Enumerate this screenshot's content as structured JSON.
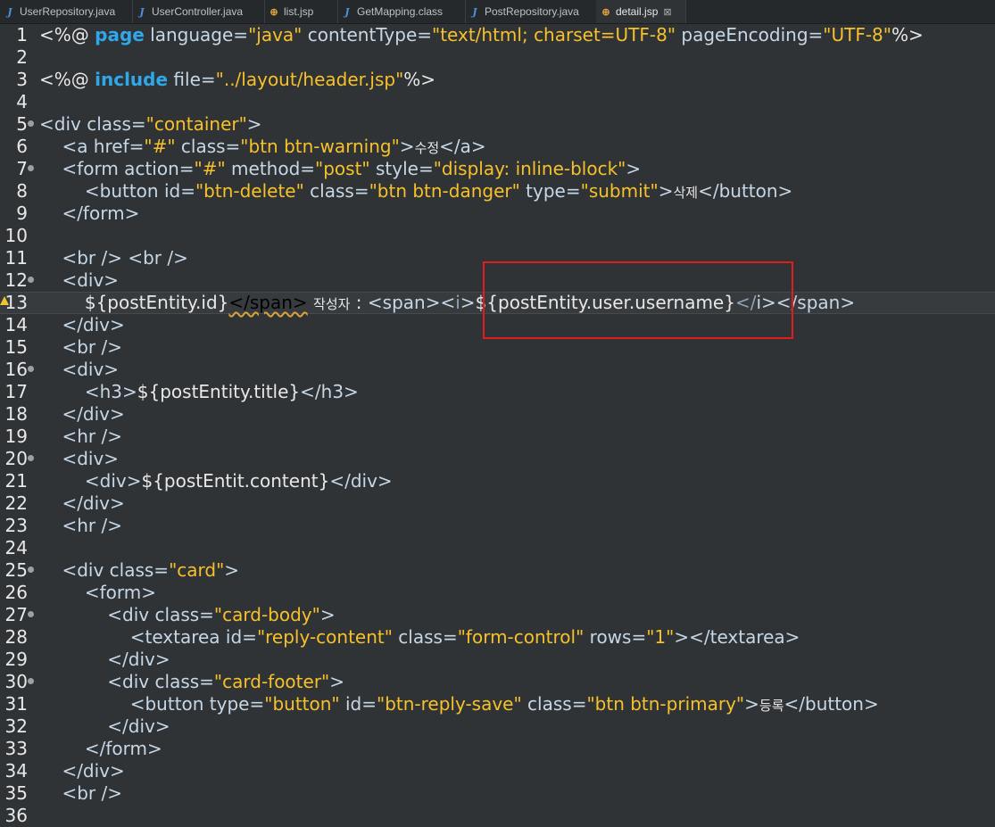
{
  "tabs": [
    {
      "label": "UserRepository.java",
      "icon": "java-class-icon",
      "active": false
    },
    {
      "label": "UserController.java",
      "icon": "java-class-icon",
      "active": false
    },
    {
      "label": "list.jsp",
      "icon": "jsp-globe-icon",
      "active": false
    },
    {
      "label": "GetMapping.class",
      "icon": "java-class-icon",
      "active": false
    },
    {
      "label": "PostRepository.java",
      "icon": "java-class-icon",
      "active": false
    },
    {
      "label": "detail.jsp",
      "icon": "jsp-globe-icon",
      "active": true,
      "close": "⊠"
    }
  ],
  "editor": {
    "current_line": 13,
    "warning_line": 13,
    "fold_lines": [
      5,
      7,
      12,
      16,
      20,
      25,
      27,
      30
    ],
    "lines": [
      {
        "n": "1",
        "tokens": [
          [
            "t",
            "<%@ "
          ],
          [
            "kw",
            "page"
          ],
          [
            "attr",
            " language="
          ],
          [
            "val",
            "\"java\""
          ],
          [
            "attr",
            " contentType="
          ],
          [
            "val",
            "\"text/html; charset=UTF-8\""
          ],
          [
            "attr",
            " pageEncoding="
          ],
          [
            "val",
            "\"UTF-8\""
          ],
          [
            "t",
            "%>"
          ]
        ]
      },
      {
        "n": "2",
        "tokens": []
      },
      {
        "n": "3",
        "tokens": [
          [
            "t",
            "<%@ "
          ],
          [
            "kw",
            "include"
          ],
          [
            "attr",
            " file="
          ],
          [
            "val",
            "\"../layout/header.jsp\""
          ],
          [
            "t",
            "%>"
          ]
        ]
      },
      {
        "n": "4",
        "tokens": []
      },
      {
        "n": "5",
        "tokens": [
          [
            "tag",
            "<div"
          ],
          [
            "attr",
            " class="
          ],
          [
            "val",
            "\"container\""
          ],
          [
            "tag",
            ">"
          ]
        ]
      },
      {
        "n": "6",
        "tokens": [
          [
            "t",
            "    "
          ],
          [
            "tag",
            "<a"
          ],
          [
            "attr",
            " href="
          ],
          [
            "val",
            "\"#\""
          ],
          [
            "attr",
            " class="
          ],
          [
            "val",
            "\"btn btn-warning\""
          ],
          [
            "tag",
            ">"
          ],
          [
            "kr",
            "수정"
          ],
          [
            "tag",
            "</a>"
          ]
        ]
      },
      {
        "n": "7",
        "tokens": [
          [
            "t",
            "    "
          ],
          [
            "tag",
            "<form"
          ],
          [
            "attr",
            " action="
          ],
          [
            "val",
            "\"#\""
          ],
          [
            "attr",
            " method="
          ],
          [
            "val",
            "\"post\""
          ],
          [
            "attr",
            " style="
          ],
          [
            "val",
            "\"display: "
          ],
          [
            "val",
            "inline-block\""
          ],
          [
            "tag",
            ">"
          ]
        ]
      },
      {
        "n": "8",
        "tokens": [
          [
            "t",
            "        "
          ],
          [
            "tag",
            "<button"
          ],
          [
            "attr",
            " id="
          ],
          [
            "val",
            "\"btn-delete\""
          ],
          [
            "attr",
            " class="
          ],
          [
            "val",
            "\"btn btn-danger\""
          ],
          [
            "attr",
            " type="
          ],
          [
            "val",
            "\"submit\""
          ],
          [
            "tag",
            ">"
          ],
          [
            "kr",
            "삭제"
          ],
          [
            "tag",
            "</button>"
          ]
        ]
      },
      {
        "n": "9",
        "tokens": [
          [
            "t",
            "    "
          ],
          [
            "tag",
            "</form>"
          ]
        ]
      },
      {
        "n": "10",
        "tokens": []
      },
      {
        "n": "11",
        "tokens": [
          [
            "t",
            "    "
          ],
          [
            "tag",
            "<br />"
          ],
          [
            "t",
            " "
          ],
          [
            "tag",
            "<br />"
          ]
        ]
      },
      {
        "n": "12",
        "tokens": [
          [
            "t",
            "    "
          ],
          [
            "tag",
            "<div>"
          ]
        ]
      },
      {
        "n": "13",
        "tokens": [
          [
            "t",
            "        ${postEntity.id}"
          ],
          [
            "ul",
            "</span>"
          ],
          [
            "t",
            " "
          ],
          [
            "kr",
            "작성자"
          ],
          [
            "t",
            " : "
          ],
          [
            "tag",
            "<span><"
          ],
          [
            "endtag",
            "i"
          ],
          [
            "tag",
            ">"
          ],
          [
            "t",
            "${postEntity.user.username}"
          ],
          [
            "endtag",
            "</"
          ],
          [
            "tag",
            "i"
          ],
          [
            "tag",
            "></span>"
          ]
        ]
      },
      {
        "n": "14",
        "tokens": [
          [
            "t",
            "    "
          ],
          [
            "tag",
            "</div>"
          ]
        ]
      },
      {
        "n": "15",
        "tokens": [
          [
            "t",
            "    "
          ],
          [
            "tag",
            "<br />"
          ]
        ]
      },
      {
        "n": "16",
        "tokens": [
          [
            "t",
            "    "
          ],
          [
            "tag",
            "<div>"
          ]
        ]
      },
      {
        "n": "17",
        "tokens": [
          [
            "t",
            "        "
          ],
          [
            "tag",
            "<h3>"
          ],
          [
            "t",
            "${postEntity.title}"
          ],
          [
            "tag",
            "</h3>"
          ]
        ]
      },
      {
        "n": "18",
        "tokens": [
          [
            "t",
            "    "
          ],
          [
            "tag",
            "</div>"
          ]
        ]
      },
      {
        "n": "19",
        "tokens": [
          [
            "t",
            "    "
          ],
          [
            "tag",
            "<hr />"
          ]
        ]
      },
      {
        "n": "20",
        "tokens": [
          [
            "t",
            "    "
          ],
          [
            "tag",
            "<div>"
          ]
        ]
      },
      {
        "n": "21",
        "tokens": [
          [
            "t",
            "        "
          ],
          [
            "tag",
            "<div>"
          ],
          [
            "t",
            "${postEntit.content}"
          ],
          [
            "tag",
            "</div>"
          ]
        ]
      },
      {
        "n": "22",
        "tokens": [
          [
            "t",
            "    "
          ],
          [
            "tag",
            "</div>"
          ]
        ]
      },
      {
        "n": "23",
        "tokens": [
          [
            "t",
            "    "
          ],
          [
            "tag",
            "<hr />"
          ]
        ]
      },
      {
        "n": "24",
        "tokens": []
      },
      {
        "n": "25",
        "tokens": [
          [
            "t",
            "    "
          ],
          [
            "tag",
            "<div"
          ],
          [
            "attr",
            " class="
          ],
          [
            "val",
            "\"card\""
          ],
          [
            "tag",
            ">"
          ]
        ]
      },
      {
        "n": "26",
        "tokens": [
          [
            "t",
            "        "
          ],
          [
            "tag",
            "<form>"
          ]
        ]
      },
      {
        "n": "27",
        "tokens": [
          [
            "t",
            "            "
          ],
          [
            "tag",
            "<div"
          ],
          [
            "attr",
            " class="
          ],
          [
            "val",
            "\"card-body\""
          ],
          [
            "tag",
            ">"
          ]
        ]
      },
      {
        "n": "28",
        "tokens": [
          [
            "t",
            "                "
          ],
          [
            "tag",
            "<textarea"
          ],
          [
            "attr",
            " id="
          ],
          [
            "val",
            "\"reply-content\""
          ],
          [
            "attr",
            " class="
          ],
          [
            "val",
            "\"form-control\""
          ],
          [
            "attr",
            " rows="
          ],
          [
            "val",
            "\"1\""
          ],
          [
            "tag",
            "></textarea>"
          ]
        ]
      },
      {
        "n": "29",
        "tokens": [
          [
            "t",
            "            "
          ],
          [
            "tag",
            "</div>"
          ]
        ]
      },
      {
        "n": "30",
        "tokens": [
          [
            "t",
            "            "
          ],
          [
            "tag",
            "<div"
          ],
          [
            "attr",
            " class="
          ],
          [
            "val",
            "\"card-footer\""
          ],
          [
            "tag",
            ">"
          ]
        ]
      },
      {
        "n": "31",
        "tokens": [
          [
            "t",
            "                "
          ],
          [
            "tag",
            "<button"
          ],
          [
            "attr",
            " type="
          ],
          [
            "val",
            "\"button\""
          ],
          [
            "attr",
            " id="
          ],
          [
            "val",
            "\"btn-reply-save\""
          ],
          [
            "attr",
            " class="
          ],
          [
            "val",
            "\"btn btn-primary\""
          ],
          [
            "tag",
            ">"
          ],
          [
            "kr",
            "등록"
          ],
          [
            "tag",
            "</button>"
          ]
        ]
      },
      {
        "n": "32",
        "tokens": [
          [
            "t",
            "            "
          ],
          [
            "tag",
            "</div>"
          ]
        ]
      },
      {
        "n": "33",
        "tokens": [
          [
            "t",
            "        "
          ],
          [
            "tag",
            "</form>"
          ]
        ]
      },
      {
        "n": "34",
        "tokens": [
          [
            "t",
            "    "
          ],
          [
            "tag",
            "</div>"
          ]
        ]
      },
      {
        "n": "35",
        "tokens": [
          [
            "t",
            "    "
          ],
          [
            "tag",
            "<br />"
          ]
        ]
      },
      {
        "n": "36",
        "tokens": []
      }
    ]
  },
  "annotation": {
    "color": "#e21c1c",
    "target": "${postEntity.user.username}"
  }
}
